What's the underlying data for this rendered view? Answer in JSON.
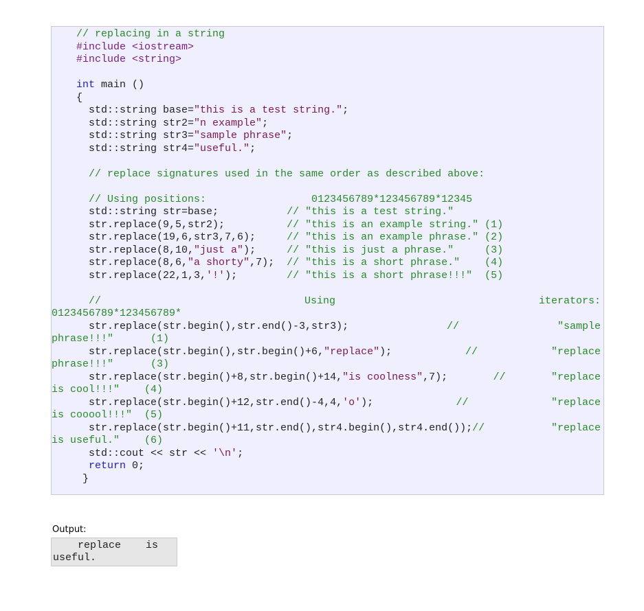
{
  "code": {
    "lines": [
      [
        {
          "t": "    // replacing in a string",
          "c": "c"
        }
      ],
      [
        {
          "t": "    #include <iostream>",
          "c": "p"
        }
      ],
      [
        {
          "t": "    #include <string>",
          "c": "p"
        }
      ],
      [
        {
          "t": ""
        }
      ],
      [
        {
          "t": "    ",
          "c": ""
        },
        {
          "t": "int",
          "c": "k"
        },
        {
          "t": " main ()",
          "c": ""
        }
      ],
      [
        {
          "t": "    {",
          "c": ""
        }
      ],
      [
        {
          "t": "      std::string base=",
          "c": ""
        },
        {
          "t": "\"this is a test string.\"",
          "c": "s"
        },
        {
          "t": ";",
          "c": ""
        }
      ],
      [
        {
          "t": "      std::string str2=",
          "c": ""
        },
        {
          "t": "\"n example\"",
          "c": "s"
        },
        {
          "t": ";",
          "c": ""
        }
      ],
      [
        {
          "t": "      std::string str3=",
          "c": ""
        },
        {
          "t": "\"sample phrase\"",
          "c": "s"
        },
        {
          "t": ";",
          "c": ""
        }
      ],
      [
        {
          "t": "      std::string str4=",
          "c": ""
        },
        {
          "t": "\"useful.\"",
          "c": "s"
        },
        {
          "t": ";",
          "c": ""
        }
      ],
      [
        {
          "t": ""
        }
      ],
      [
        {
          "t": "      // replace signatures used in the same order as described above:",
          "c": "c"
        }
      ],
      [
        {
          "t": ""
        }
      ],
      [
        {
          "t": "      // Using positions:                 0123456789*123456789*12345",
          "c": "c"
        }
      ],
      [
        {
          "t": "      std::string str=base;           ",
          "c": ""
        },
        {
          "t": "// \"this is a test string.\"",
          "c": "c"
        }
      ],
      [
        {
          "t": "      str.replace(9,5,str2);          ",
          "c": ""
        },
        {
          "t": "// \"this is an example string.\" (1)",
          "c": "c"
        }
      ],
      [
        {
          "t": "      str.replace(19,6,str3,7,6);     ",
          "c": ""
        },
        {
          "t": "// \"this is an example phrase.\" (2)",
          "c": "c"
        }
      ],
      [
        {
          "t": "      str.replace(8,10,",
          "c": ""
        },
        {
          "t": "\"just a\"",
          "c": "s"
        },
        {
          "t": ");     ",
          "c": ""
        },
        {
          "t": "// \"this is just a phrase.\"     (3)",
          "c": "c"
        }
      ],
      [
        {
          "t": "      str.replace(8,6,",
          "c": ""
        },
        {
          "t": "\"a shorty\"",
          "c": "s"
        },
        {
          "t": ",7);  ",
          "c": ""
        },
        {
          "t": "// \"this is a short phrase.\"    (4)",
          "c": "c"
        }
      ],
      [
        {
          "t": "      str.replace(22,1,3,",
          "c": ""
        },
        {
          "t": "'!'",
          "c": "s"
        },
        {
          "t": ");        ",
          "c": ""
        },
        {
          "t": "// \"this is a short phrase!!!\"  (5)",
          "c": "c"
        }
      ],
      [
        {
          "t": ""
        }
      ]
    ],
    "wrapped": [
      {
        "first": [
          [
            {
              "t": "      //",
              "c": "c"
            }
          ],
          [
            {
              "t": "Using",
              "c": "c"
            }
          ],
          [
            {
              "t": "iterators:",
              "c": "c"
            }
          ]
        ],
        "second": [
          {
            "t": "0123456789*123456789*",
            "c": "c"
          }
        ]
      },
      {
        "first": [
          [
            {
              "t": "      str.replace(str.begin(),str.end()-3,str3);",
              "c": ""
            }
          ],
          [
            {
              "t": "//",
              "c": "c"
            }
          ],
          [
            {
              "t": "\"sample",
              "c": "c"
            }
          ]
        ],
        "second": [
          {
            "t": "phrase!!!\"      (1)",
            "c": "c"
          }
        ]
      },
      {
        "first": [
          [
            {
              "t": "      str.replace(str.begin(),str.begin()+6,",
              "c": ""
            },
            {
              "t": "\"replace\"",
              "c": "s"
            },
            {
              "t": ");",
              "c": ""
            }
          ],
          [
            {
              "t": "//",
              "c": "c"
            }
          ],
          [
            {
              "t": "\"replace",
              "c": "c"
            }
          ]
        ],
        "second": [
          {
            "t": "phrase!!!\"      (3)",
            "c": "c"
          }
        ]
      },
      {
        "first": [
          [
            {
              "t": "      str.replace(str.begin()+8,str.begin()+14,",
              "c": ""
            },
            {
              "t": "\"is coolness\"",
              "c": "s"
            },
            {
              "t": ",7);",
              "c": ""
            }
          ],
          [
            {
              "t": "//",
              "c": "c"
            }
          ],
          [
            {
              "t": "\"replace",
              "c": "c"
            }
          ]
        ],
        "second": [
          {
            "t": "is cool!!!\"    (4)",
            "c": "c"
          }
        ]
      },
      {
        "first": [
          [
            {
              "t": "      str.replace(str.begin()+12,str.end()-4,4,",
              "c": ""
            },
            {
              "t": "'o'",
              "c": "s"
            },
            {
              "t": ");",
              "c": ""
            }
          ],
          [
            {
              "t": "//",
              "c": "c"
            }
          ],
          [
            {
              "t": "\"replace",
              "c": "c"
            }
          ]
        ],
        "second": [
          {
            "t": "is cooool!!!\"  (5)",
            "c": "c"
          }
        ]
      },
      {
        "first": [
          [
            {
              "t": "      str.replace(str.begin()+11,str.end(),str4.begin(),str4.end());",
              "c": ""
            },
            {
              "t": "//",
              "c": "c"
            }
          ],
          [
            {
              "t": "\"replace",
              "c": "c"
            }
          ]
        ],
        "second": [
          {
            "t": "is useful.\"    (6)",
            "c": "c"
          }
        ]
      }
    ],
    "tail": [
      [
        {
          "t": "      std::cout << str << ",
          "c": ""
        },
        {
          "t": "'\\n'",
          "c": "s"
        },
        {
          "t": ";",
          "c": ""
        }
      ],
      [
        {
          "t": "      ",
          "c": ""
        },
        {
          "t": "return",
          "c": "k"
        },
        {
          "t": " 0;",
          "c": ""
        }
      ],
      [
        {
          "t": "     }",
          "c": ""
        }
      ]
    ]
  },
  "output": {
    "label": "Output:",
    "lines": [
      "    replace    is",
      "useful."
    ]
  }
}
